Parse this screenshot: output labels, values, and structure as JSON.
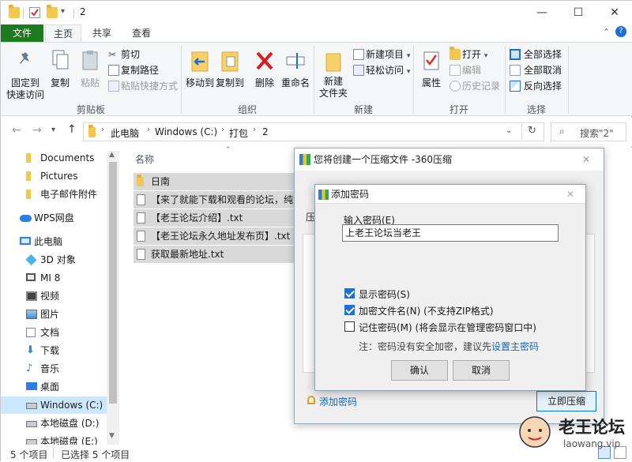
{
  "window": {
    "path_title": "2"
  },
  "tabs": {
    "file": "文件",
    "home": "主页",
    "share": "共享",
    "view": "查看"
  },
  "ribbon": {
    "clipboard": {
      "pin": "固定到\n快速访问",
      "copy": "复制",
      "paste": "粘贴",
      "cut": "剪切",
      "copy_path": "复制路径",
      "paste_shortcut": "粘贴快捷方式",
      "label": "剪贴板"
    },
    "organize": {
      "move_to": "移动到",
      "copy_to": "复制到",
      "delete": "删除",
      "rename": "重命名",
      "label": "组织"
    },
    "new": {
      "new_folder": "新建\n文件夹",
      "new_item": "新建项目",
      "easy_access": "轻松访问",
      "label": "新建"
    },
    "open": {
      "properties": "属性",
      "open": "打开",
      "edit": "编辑",
      "history": "历史记录",
      "label": "打开"
    },
    "select": {
      "select_all": "全部选择",
      "select_none": "全部取消",
      "invert": "反向选择",
      "label": "选择"
    }
  },
  "nav": {
    "breadcrumb": [
      "此电脑",
      "Windows (C:)",
      "打包",
      "2"
    ],
    "search_placeholder": "搜索\"2\""
  },
  "navpane": {
    "items": [
      {
        "label": "Documents",
        "icon": "folder-icon"
      },
      {
        "label": "Pictures",
        "icon": "folder-icon"
      },
      {
        "label": "电子邮件附件",
        "icon": "folder-icon"
      },
      {
        "label": "WPS网盘",
        "icon": "cloud-icon"
      },
      {
        "label": "此电脑",
        "icon": "computer-icon"
      },
      {
        "label": "3D 对象",
        "icon": "cube-icon"
      },
      {
        "label": "MI 8",
        "icon": "phone-icon"
      },
      {
        "label": "视频",
        "icon": "video-icon"
      },
      {
        "label": "图片",
        "icon": "image-icon"
      },
      {
        "label": "文档",
        "icon": "document-icon"
      },
      {
        "label": "下载",
        "icon": "download-icon"
      },
      {
        "label": "音乐",
        "icon": "music-icon"
      },
      {
        "label": "桌面",
        "icon": "desktop-icon"
      },
      {
        "label": "Windows (C:)",
        "icon": "drive-icon"
      },
      {
        "label": "本地磁盘 (D:)",
        "icon": "drive-icon"
      },
      {
        "label": "本地磁盘 (E:)",
        "icon": "drive-icon"
      }
    ]
  },
  "content": {
    "column_name": "名称",
    "files": [
      {
        "name": "日南",
        "type": "folder"
      },
      {
        "name": "【来了就能下载和观看的论坛，纯免",
        "type": "txt"
      },
      {
        "name": "【老王论坛介绍】.txt",
        "type": "txt"
      },
      {
        "name": "【老王论坛永久地址发布页】.txt",
        "type": "txt"
      },
      {
        "name": "获取最新地址.txt",
        "type": "txt"
      }
    ]
  },
  "status": {
    "count": "5 个项目",
    "selected": "已选择 5 个项目"
  },
  "dialog360": {
    "title": "您将创建一个压缩文件 -360压缩",
    "partial_label": "压",
    "add_password": "添加密码",
    "compress_now": "立即压缩"
  },
  "dialog_password": {
    "title": "添加密码",
    "input_label": "输入密码(E)",
    "password_value": "上老王论坛当老王",
    "show_password": "显示密码(S)",
    "encrypt_names": "加密文件名(N) (不支持ZIP格式)",
    "remember": "记住密码(M) (将会显示在管理密码窗口中)",
    "note_prefix": "注：密码没有安全加密，建议先",
    "note_link": "设置主密码",
    "ok": "确认",
    "cancel": "取消",
    "show_password_checked": true,
    "encrypt_names_checked": true,
    "remember_checked": false
  },
  "watermark": {
    "brand": "老王论坛",
    "url": "laowang.vip"
  },
  "colors": {
    "file_tab": "#1e7a1e",
    "selected_row": "#d9d9d9",
    "nav_selected": "#cce8ff",
    "link": "#1565c0",
    "checkbox": "#1f6fd1"
  }
}
